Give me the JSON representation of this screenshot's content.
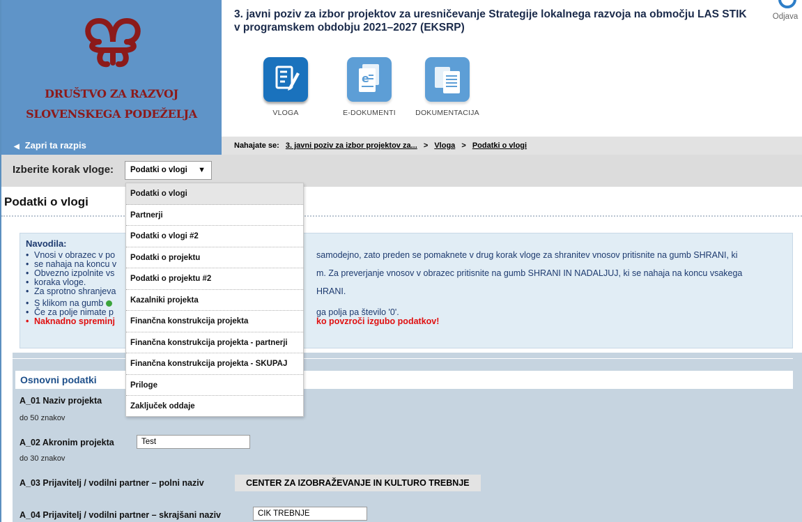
{
  "org": {
    "line1": "DRUŠTVO ZA RAZVOJ",
    "line2": "SLOVENSKEGA PODEŽELJA",
    "logo_icon": "knot-logo-icon",
    "logo_color": "#8c1a1a"
  },
  "header": {
    "title": "3. javni poziv za izbor projektov za uresničevanje Strategije lokalnega razvoja na območju LAS STIK v programskem obdobju 2021–2027 (EKSRP)",
    "logout_label": "Odjava",
    "logout_icon": "power-icon"
  },
  "toolbar": {
    "items": [
      {
        "label": "VLOGA",
        "icon": "form-pencil-icon"
      },
      {
        "label": "E-DOKUMENTI",
        "icon": "e-document-icon"
      },
      {
        "label": "DOKUMENTACIJA",
        "icon": "documents-icon"
      }
    ]
  },
  "nav": {
    "close_call": "Zapri ta razpis",
    "close_icon": "caret-left-icon",
    "breadcrumb_label": "Nahajate se:",
    "breadcrumb": [
      "3. javni poziv za izbor projektov za...",
      "Vloga",
      "Podatki o vlogi"
    ],
    "separator": ">"
  },
  "step": {
    "label": "Izberite korak vloge:",
    "selected": "Podatki o vlogi",
    "arrow": "▼",
    "options": [
      "Podatki o vlogi",
      "Partnerji",
      "Podatki o vlogi #2",
      "Podatki o projektu",
      "Podatki o projektu #2",
      "Kazalniki projekta",
      "Finančna konstrukcija projekta",
      "Finančna konstrukcija projekta - partnerji",
      "Finančna konstrukcija projekta - SKUPAJ",
      "Priloge",
      "Zaključek oddaje"
    ]
  },
  "page_title": "Podatki o vlogi",
  "instructions": {
    "title": "Navodila:",
    "items": [
      {
        "pre": "Vnosi v obrazec v po",
        "post": "samodejno, zato preden se pomaknete v drug korak vloge za shranitev vnosov pritisnite na gumb SHRANI, ki"
      },
      {
        "pre": "se nahaja na koncu v",
        "post": ""
      },
      {
        "pre": "Obvezno izpolnite vs",
        "post": "m. Za preverjanje vnosov v obrazec pritisnite na gumb SHRANI IN NADALJUJ, ki se nahaja na koncu vsakega"
      },
      {
        "pre": "koraka vloge.",
        "post": ""
      },
      {
        "pre": "Za sprotno shranjeva",
        "post": "HRANI."
      },
      {
        "pre": "S klikom na gumb",
        "post": ""
      },
      {
        "pre": "Če za polje nimate p",
        "post": "ga polja pa število '0'."
      },
      {
        "pre": "Naknadno spreminj",
        "post": "ko povzroči izgubo podatkov!"
      }
    ]
  },
  "form": {
    "section_title": "Osnovni podatki",
    "a01_label": "A_01 Naziv projekta",
    "a01_hint": "do 50 znakov",
    "a02_label": "A_02 Akronim projekta",
    "a02_value": "Test",
    "a02_hint": "do 30 znakov",
    "a03_label": "A_03 Prijavitelj / vodilni partner – polni naziv",
    "a03_value": "CENTER ZA IZOBRAŽEVANJE IN KULTURO TREBNJE",
    "a04_label": "A_04 Prijavitelj / vodilni partner – skrajšani naziv",
    "a04_value": "CIK TREBNJE"
  },
  "colors": {
    "brand_blue": "#5f94c8",
    "text_navy": "#1d3a6f",
    "warning_red": "#e01010",
    "form_bg": "#c6d4e0"
  }
}
